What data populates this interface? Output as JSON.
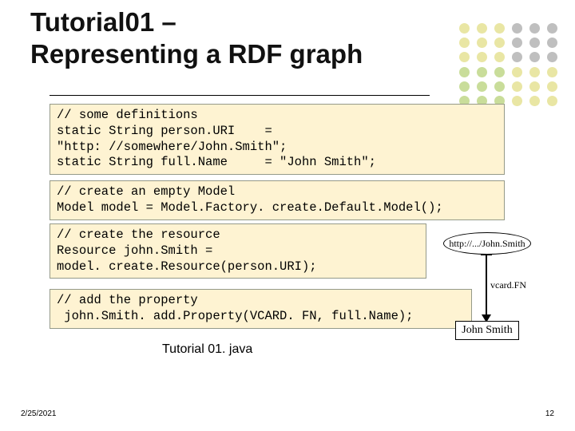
{
  "title_line1": "Tutorial01 –",
  "title_line2": "Representing a RDF graph",
  "code": {
    "block1": "// some definitions\nstatic String person.URI    =\n\"http: //somewhere/John.Smith\";\nstatic String full.Name     = \"John Smith\";",
    "block2": "// create an empty Model\nModel model = Model.Factory. create.Default.Model();",
    "block3": "// create the resource\nResource john.Smith =\nmodel. create.Resource(person.URI);",
    "block4": "// add the property\n john.Smith. add.Property(VCARD. FN, full.Name);"
  },
  "fileLabel": "Tutorial 01. java",
  "footerDate": "2/25/2021",
  "pageNumber": "12",
  "graph": {
    "topNode": "http://.../John.Smith",
    "edge": "vcard.FN",
    "bottomNode": "John Smith"
  }
}
